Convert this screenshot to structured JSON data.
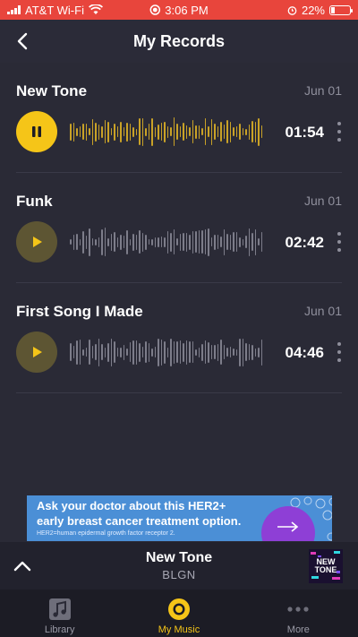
{
  "status_bar": {
    "carrier": "AT&T Wi-Fi",
    "time": "3:06 PM",
    "battery": "22%",
    "battery_level": 0.22,
    "background_color": "#e8453c"
  },
  "header": {
    "title": "My Records",
    "back_icon": "chevron-left-icon"
  },
  "records": [
    {
      "title": "New Tone",
      "date": "Jun 01",
      "duration": "01:54",
      "state": "playing",
      "control_icon": "pause-icon"
    },
    {
      "title": "Funk",
      "date": "Jun 01",
      "duration": "02:42",
      "state": "stopped",
      "control_icon": "play-icon"
    },
    {
      "title": "First Song I Made",
      "date": "Jun 01",
      "duration": "04:46",
      "state": "stopped",
      "control_icon": "play-icon"
    }
  ],
  "ad": {
    "line1": "Ask your doctor about this HER2+",
    "line2": "early breast cancer treatment option.",
    "line3": "HER2=human epidermal growth factor receptor 2."
  },
  "mini_player": {
    "title": "New Tone",
    "artist": "BLGN",
    "expand_icon": "chevron-up-icon",
    "art_text": "NEW TONE"
  },
  "tabs": [
    {
      "label": "Library",
      "icon": "music-library-icon",
      "active": false
    },
    {
      "label": "My Music",
      "icon": "record-icon",
      "active": true
    },
    {
      "label": "More",
      "icon": "more-dots-icon",
      "active": false
    }
  ],
  "colors": {
    "accent": "#f5c518",
    "background": "#2a2a36",
    "waveform_active": "#c9a227",
    "waveform_idle": "#7d7d8a",
    "muted_text": "#8f8f9c"
  }
}
